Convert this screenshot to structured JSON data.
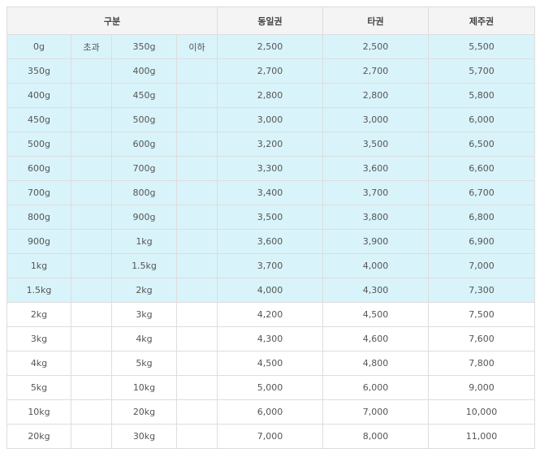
{
  "header": {
    "category": "구분",
    "zone_mainland": "동일권",
    "zone_other": "타권",
    "zone_jeju": "제주권"
  },
  "rows": [
    {
      "from": "0g",
      "over_label": "초과",
      "to": "350g",
      "under_label": "이하",
      "mainland": "2,500",
      "other": "2,500",
      "jeju": "5,500"
    },
    {
      "from": "350g",
      "over_label": "",
      "to": "400g",
      "under_label": "",
      "mainland": "2,700",
      "other": "2,700",
      "jeju": "5,700"
    },
    {
      "from": "400g",
      "over_label": "",
      "to": "450g",
      "under_label": "",
      "mainland": "2,800",
      "other": "2,800",
      "jeju": "5,800"
    },
    {
      "from": "450g",
      "over_label": "",
      "to": "500g",
      "under_label": "",
      "mainland": "3,000",
      "other": "3,000",
      "jeju": "6,000"
    },
    {
      "from": "500g",
      "over_label": "",
      "to": "600g",
      "under_label": "",
      "mainland": "3,200",
      "other": "3,500",
      "jeju": "6,500"
    },
    {
      "from": "600g",
      "over_label": "",
      "to": "700g",
      "under_label": "",
      "mainland": "3,300",
      "other": "3,600",
      "jeju": "6,600"
    },
    {
      "from": "700g",
      "over_label": "",
      "to": "800g",
      "under_label": "",
      "mainland": "3,400",
      "other": "3,700",
      "jeju": "6,700"
    },
    {
      "from": "800g",
      "over_label": "",
      "to": "900g",
      "under_label": "",
      "mainland": "3,500",
      "other": "3,800",
      "jeju": "6,800"
    },
    {
      "from": "900g",
      "over_label": "",
      "to": "1kg",
      "under_label": "",
      "mainland": "3,600",
      "other": "3,900",
      "jeju": "6,900"
    },
    {
      "from": "1kg",
      "over_label": "",
      "to": "1.5kg",
      "under_label": "",
      "mainland": "3,700",
      "other": "4,000",
      "jeju": "7,000"
    },
    {
      "from": "1.5kg",
      "over_label": "",
      "to": "2kg",
      "under_label": "",
      "mainland": "4,000",
      "other": "4,300",
      "jeju": "7,300"
    },
    {
      "from": "2kg",
      "over_label": "",
      "to": "3kg",
      "under_label": "",
      "mainland": "4,200",
      "other": "4,500",
      "jeju": "7,500"
    },
    {
      "from": "3kg",
      "over_label": "",
      "to": "4kg",
      "under_label": "",
      "mainland": "4,300",
      "other": "4,600",
      "jeju": "7,600"
    },
    {
      "from": "4kg",
      "over_label": "",
      "to": "5kg",
      "under_label": "",
      "mainland": "4,500",
      "other": "4,800",
      "jeju": "7,800"
    },
    {
      "from": "5kg",
      "over_label": "",
      "to": "10kg",
      "under_label": "",
      "mainland": "5,000",
      "other": "6,000",
      "jeju": "9,000"
    },
    {
      "from": "10kg",
      "over_label": "",
      "to": "20kg",
      "under_label": "",
      "mainland": "6,000",
      "other": "7,000",
      "jeju": "10,000"
    },
    {
      "from": "20kg",
      "over_label": "",
      "to": "30kg",
      "under_label": "",
      "mainland": "7,000",
      "other": "8,000",
      "jeju": "11,000"
    }
  ],
  "colors": {
    "header_bg": "#f4f4f4",
    "highlight_row_bg": "#d9f3fa",
    "plain_row_bg": "#ffffff",
    "border": "#dddddd",
    "text": "#555555"
  }
}
